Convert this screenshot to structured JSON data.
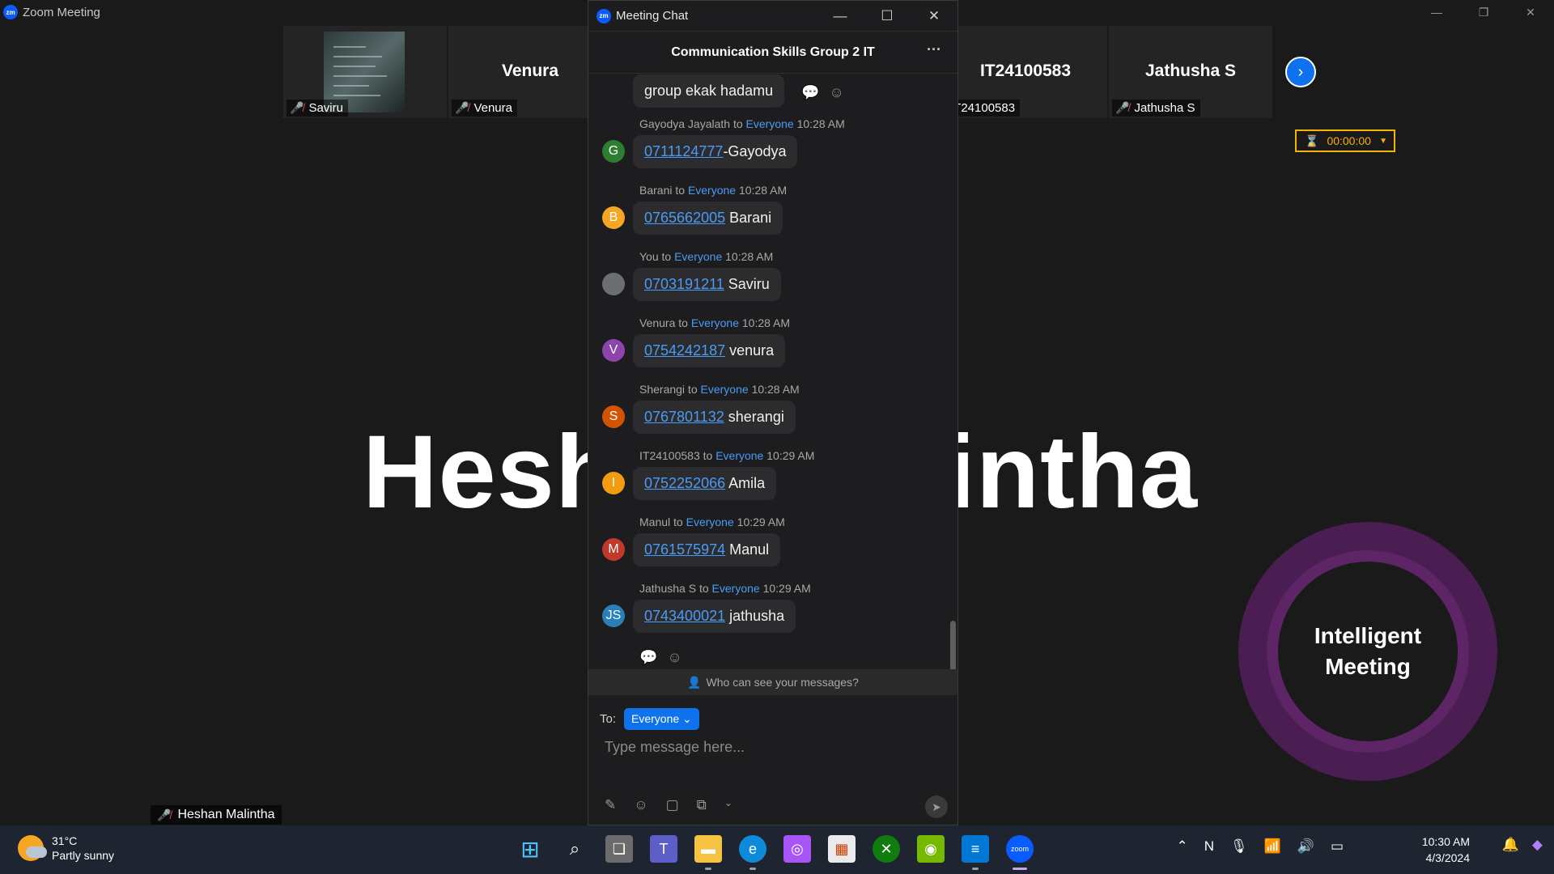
{
  "zoom_window": {
    "title": "Zoom Meeting"
  },
  "participants": [
    {
      "big": "",
      "small": "Saviru"
    },
    {
      "big": "Venura",
      "small": "Venura"
    },
    {
      "big": "IT24100583",
      "small": "IT24100583"
    },
    {
      "big": "Jathusha S",
      "small": "Jathusha S"
    }
  ],
  "timer": {
    "value": "00:00:00"
  },
  "main_view": {
    "speaker_name": "Heshan Malintha",
    "bottom_label": "Heshan Malintha"
  },
  "intelligent_badge": {
    "line1": "Intelligent",
    "line2": "Meeting"
  },
  "chat": {
    "window_title": "Meeting Chat",
    "group_name": "Communication Skills Group 2 IT",
    "first_message": "group ekak hadamu",
    "messages": [
      {
        "sender": "Gayodya Jayalath",
        "to": "Everyone",
        "time": "10:28 AM",
        "initial": "G",
        "color": "#2e7d32",
        "phone": "0711124777",
        "text": "-Gayodya"
      },
      {
        "sender": "Barani",
        "to": "Everyone",
        "time": "10:28 AM",
        "initial": "B",
        "color": "#f5a623",
        "phone": "0765662005",
        "text": " Barani"
      },
      {
        "sender": "You",
        "to": "Everyone",
        "time": "10:28 AM",
        "initial": "",
        "color": "#6a7070",
        "phone": "0703191211",
        "text": " Saviru"
      },
      {
        "sender": "Venura",
        "to": "Everyone",
        "time": "10:28 AM",
        "initial": "V",
        "color": "#8e44ad",
        "phone": "0754242187",
        "text": " venura"
      },
      {
        "sender": "Sherangi",
        "to": "Everyone",
        "time": "10:28 AM",
        "initial": "S",
        "color": "#d35400",
        "phone": "0767801132",
        "text": " sherangi"
      },
      {
        "sender": "IT24100583",
        "to": "Everyone",
        "time": "10:29 AM",
        "initial": "I",
        "color": "#f39c12",
        "phone": "0752252066",
        "text": " Amila"
      },
      {
        "sender": "Manul",
        "to": "Everyone",
        "time": "10:29 AM",
        "initial": "M",
        "color": "#c0392b",
        "phone": "0761575974",
        "text": " Manul"
      },
      {
        "sender": "Jathusha S",
        "to": "Everyone",
        "time": "10:29 AM",
        "initial": "JS",
        "color": "#2980b9",
        "phone": "0743400021",
        "text": " jathusha"
      }
    ],
    "who_can_see": "Who can see your messages?",
    "to_label": "To:",
    "to_value": "Everyone",
    "input_placeholder": "Type message here..."
  },
  "taskbar": {
    "temperature": "31°C",
    "weather": "Partly sunny",
    "time": "10:30 AM",
    "date": "4/3/2024"
  }
}
